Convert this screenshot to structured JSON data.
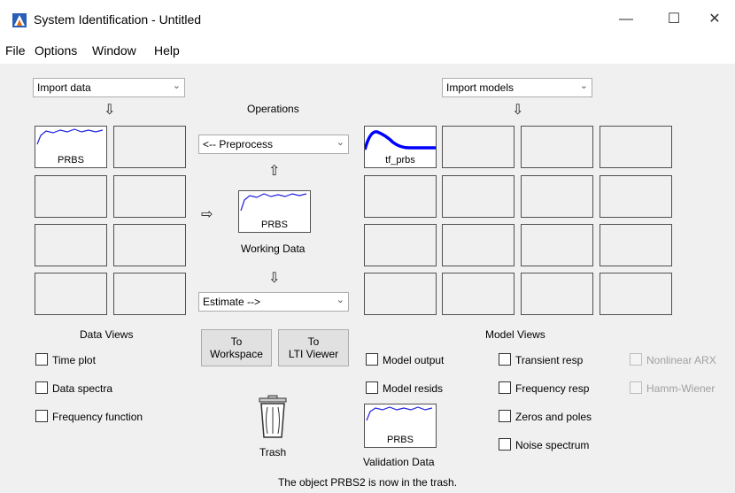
{
  "window": {
    "title": "System Identification - Untitled",
    "minimize": "—",
    "maximize": "☐",
    "close": "✕"
  },
  "menu": [
    "File",
    "Options",
    "Window",
    "Help"
  ],
  "data_panel": {
    "import_dropdown": "Import data",
    "slot_label": "PRBS",
    "views_title": "Data Views",
    "views": [
      "Time plot",
      "Data spectra",
      "Frequency function"
    ]
  },
  "operations": {
    "title": "Operations",
    "preprocess_dropdown": "<-- Preprocess",
    "working_data_slot": "PRBS",
    "working_data_caption": "Working Data",
    "estimate_dropdown": "Estimate -->",
    "to_workspace": [
      "To",
      "Workspace"
    ],
    "to_lti_viewer": [
      "To",
      "LTI Viewer"
    ],
    "trash_caption": "Trash"
  },
  "model_panel": {
    "import_dropdown": "Import models",
    "slot_label": "tf_prbs",
    "views_title": "Model Views",
    "views_col1": [
      "Model output",
      "Model resids"
    ],
    "views_col2": [
      "Transient resp",
      "Frequency resp",
      "Zeros and poles",
      "Noise spectrum"
    ],
    "views_col3": [
      "Nonlinear ARX",
      "Hamm-Wiener"
    ]
  },
  "validation": {
    "slot_label": "PRBS",
    "caption": "Validation Data"
  },
  "status": "The object PRBS2 is now in the trash.",
  "colors": {
    "plot_line": "#2020e0",
    "model_line": "#0000ff"
  }
}
